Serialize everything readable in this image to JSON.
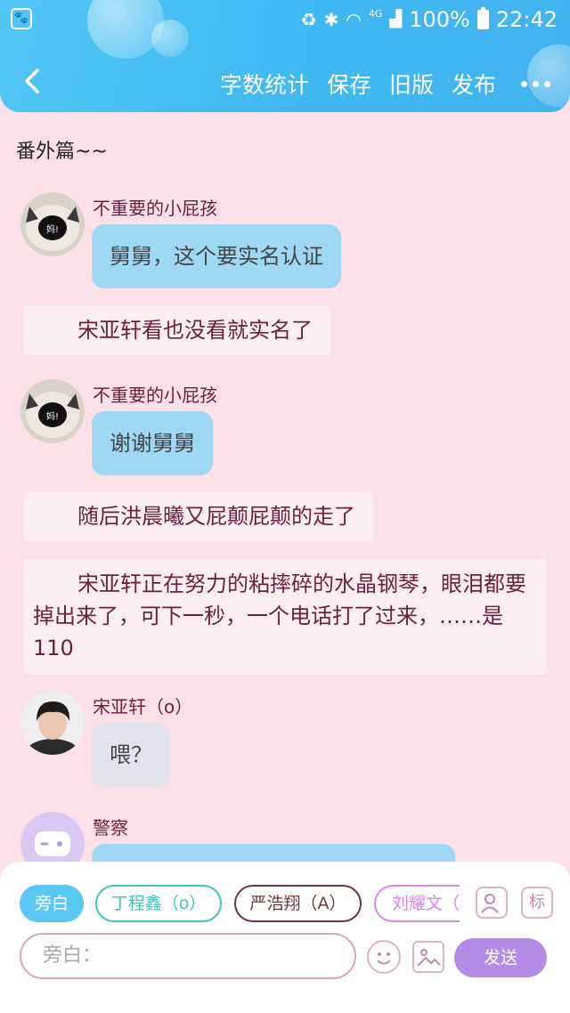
{
  "status_bar": {
    "battery": "100%",
    "time": "22:42",
    "signal_label": "4G"
  },
  "nav": {
    "actions": [
      "字数统计",
      "保存",
      "旧版",
      "发布"
    ]
  },
  "chapter_title": "番外篇~~",
  "messages": [
    {
      "type": "dialog",
      "sender": "不重要的小屁孩",
      "avatar_badge": "妈!",
      "text": "舅舅，这个要实名认证",
      "bubble": "blue"
    },
    {
      "type": "narration",
      "text": "宋亚轩看也没看就实名了"
    },
    {
      "type": "dialog",
      "sender": "不重要的小屁孩",
      "avatar_badge": "妈!",
      "text": "谢谢舅舅",
      "bubble": "blue"
    },
    {
      "type": "narration",
      "text": "随后洪晨曦又屁颠屁颠的走了"
    },
    {
      "type": "narration",
      "text": "宋亚轩正在努力的粘摔碎的水晶钢琴，眼泪都要掉出来了，可下一秒，一个电话打了过来，……是110"
    },
    {
      "type": "dialog",
      "sender": "宋亚轩（o）",
      "text": "喂？",
      "bubble": "grey"
    },
    {
      "type": "dialog",
      "sender": "警察",
      "text": "",
      "bubble": "blue"
    }
  ],
  "roles": [
    {
      "label": "旁白",
      "active": true,
      "color": "#5ac8f2"
    },
    {
      "label": "丁程鑫（o）",
      "active": false,
      "color": "#44c4b6"
    },
    {
      "label": "严浩翔（A）",
      "active": false,
      "color": "#6b3b3b"
    },
    {
      "label": "刘耀文（A）",
      "active": false,
      "color": "#d887e0"
    }
  ],
  "tools": {
    "mark_label": "标"
  },
  "input": {
    "placeholder": "旁白："
  },
  "send_label": "发送",
  "colors": {
    "header": "#3fb8f1",
    "background": "#fbe0e8",
    "send": "#b48ce8",
    "sender_text": "#6b1f40"
  }
}
